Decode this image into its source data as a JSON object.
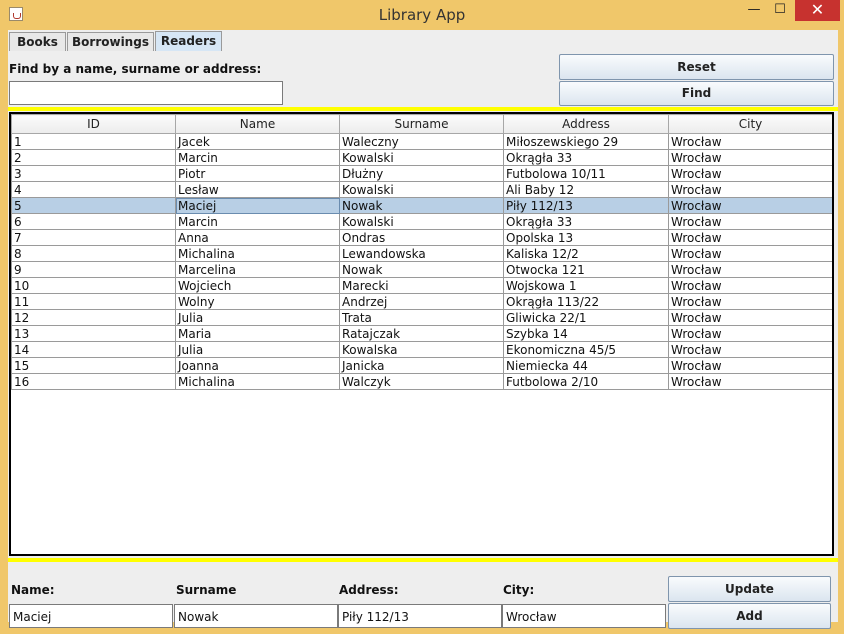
{
  "window": {
    "title": "Library App",
    "minimize_glyph": "—",
    "maximize_glyph": "☐",
    "close_glyph": "✕"
  },
  "tabs": [
    {
      "label": "Books"
    },
    {
      "label": "Borrowings"
    },
    {
      "label": "Readers"
    }
  ],
  "search": {
    "label": "Find by a name, surname or address:",
    "value": "",
    "reset_label": "Reset",
    "find_label": "Find"
  },
  "table": {
    "headers": [
      "ID",
      "Name",
      "Surname",
      "Address",
      "City"
    ],
    "selected_row": 5,
    "rows": [
      [
        "1",
        "Jacek",
        "Waleczny",
        "Miłoszewskiego 29",
        "Wrocław"
      ],
      [
        "2",
        "Marcin",
        "Kowalski",
        "Okrągła 33",
        "Wrocław"
      ],
      [
        "3",
        "Piotr",
        "Dłużny",
        "Futbolowa 10/11",
        "Wrocław"
      ],
      [
        "4",
        "Lesław",
        "Kowalski",
        "Ali Baby 12",
        "Wrocław"
      ],
      [
        "5",
        "Maciej",
        "Nowak",
        "Piły 112/13",
        "Wrocław"
      ],
      [
        "6",
        "Marcin",
        "Kowalski",
        "Okrągła 33",
        "Wrocław"
      ],
      [
        "7",
        "Anna",
        "Ondras",
        "Opolska 13",
        "Wrocław"
      ],
      [
        "8",
        "Michalina",
        "Lewandowska",
        "Kaliska 12/2",
        "Wrocław"
      ],
      [
        "9",
        "Marcelina",
        "Nowak",
        "Otwocka 121",
        "Wrocław"
      ],
      [
        "10",
        "Wojciech",
        "Marecki",
        "Wojskowa 1",
        "Wrocław"
      ],
      [
        "11",
        "Wolny",
        "Andrzej",
        "Okrągła 113/22",
        "Wrocław"
      ],
      [
        "12",
        "Julia",
        "Trata",
        "Gliwicka 22/1",
        "Wrocław"
      ],
      [
        "13",
        "Maria",
        "Ratajczak",
        "Szybka 14",
        "Wrocław"
      ],
      [
        "14",
        "Julia",
        "Kowalska",
        "Ekonomiczna 45/5",
        "Wrocław"
      ],
      [
        "15",
        "Joanna",
        "Janicka",
        "Niemiecka 44",
        "Wrocław"
      ],
      [
        "16",
        "Michalina",
        "Walczyk",
        "Futbolowa 2/10",
        "Wrocław"
      ]
    ]
  },
  "form": {
    "name_label": "Name:",
    "surname_label": "Surname",
    "address_label": "Address:",
    "city_label": "City:",
    "name_value": "Maciej",
    "surname_value": "Nowak",
    "address_value": "Piły 112/13",
    "city_value": "Wrocław",
    "update_label": "Update",
    "add_label": "Add"
  },
  "colors": {
    "frame": "#f0c76a",
    "separator": "#ffff00",
    "selection": "#b8cfe5",
    "active_tab": "#d6e6f5",
    "close_button": "#c7322f"
  }
}
